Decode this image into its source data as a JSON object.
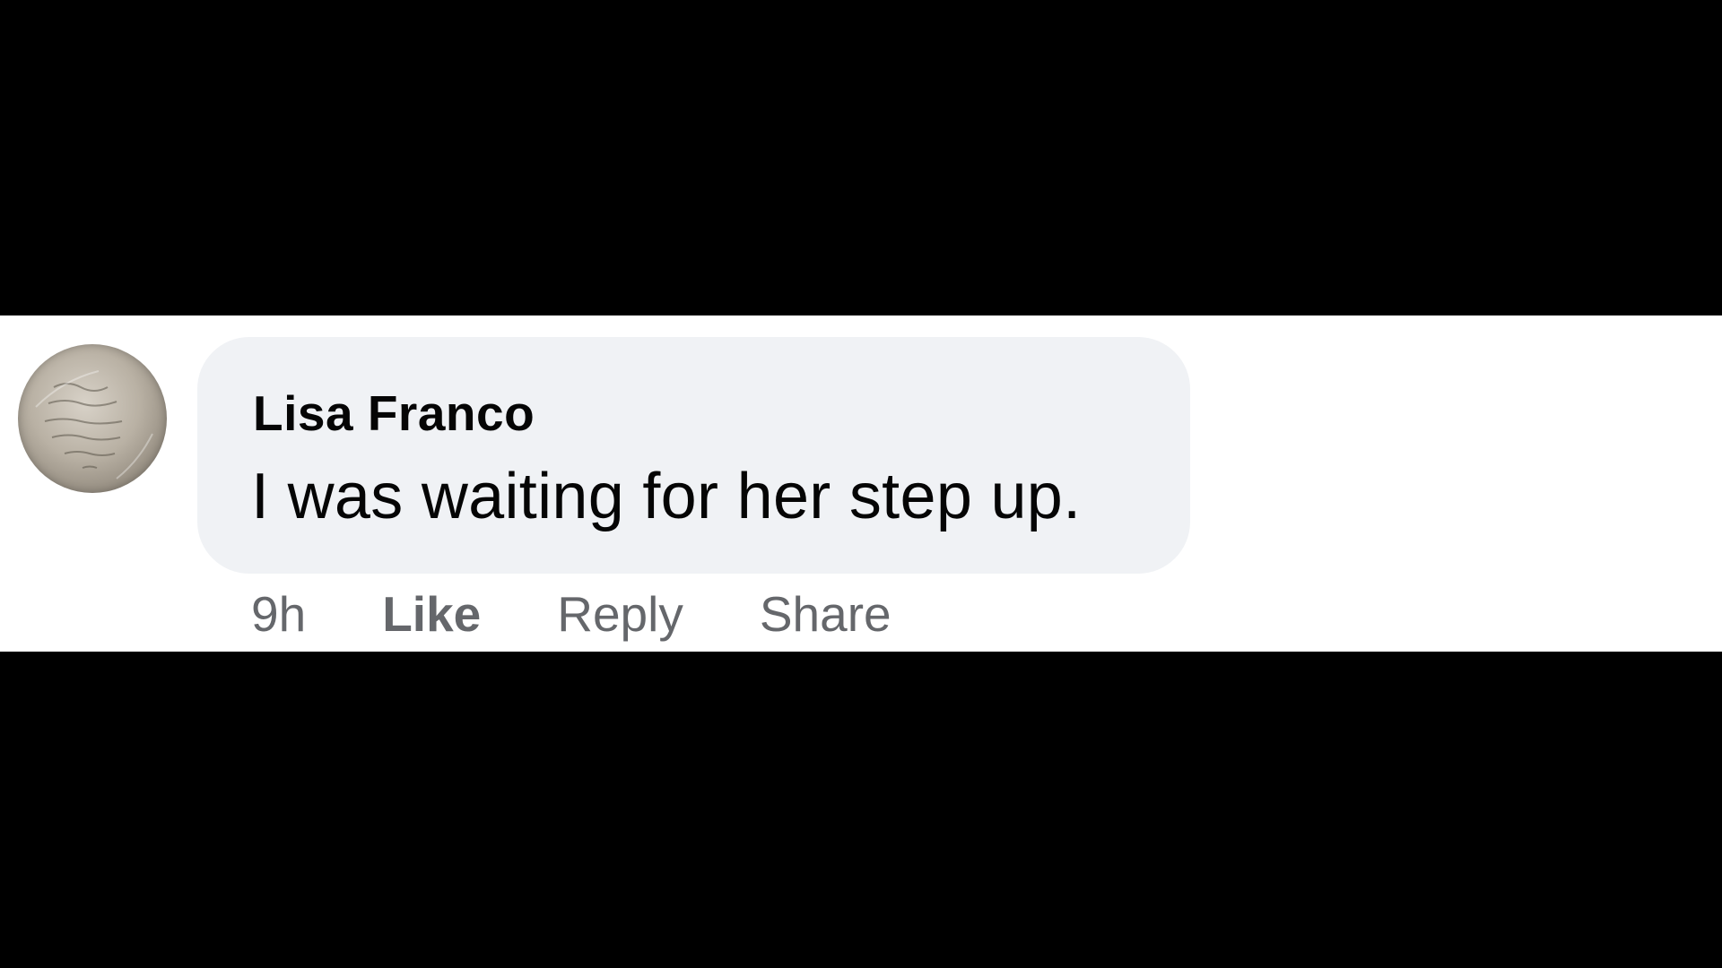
{
  "comment": {
    "author": "Lisa Franco",
    "text": "I was waiting for her step up.",
    "timestamp": "9h",
    "actions": {
      "like_label": "Like",
      "reply_label": "Reply",
      "share_label": "Share"
    },
    "avatar": {
      "icon": "profile-photo-avatar"
    },
    "colors": {
      "bubble": "#f0f2f5",
      "text": "#050505",
      "secondary_text": "#65676b",
      "letterbox": "#000000"
    }
  }
}
